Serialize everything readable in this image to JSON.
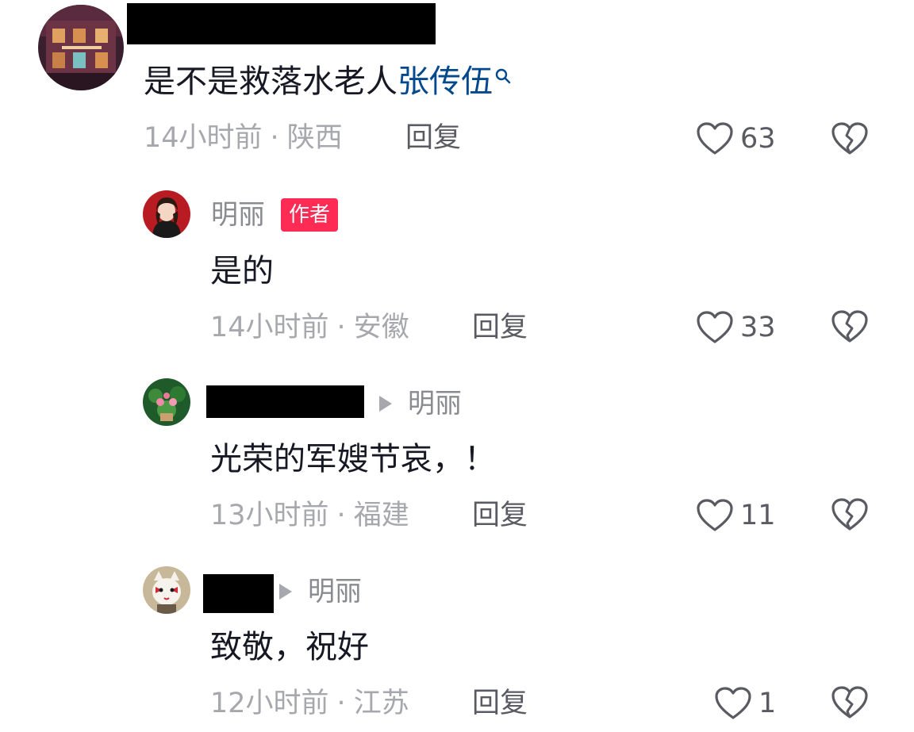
{
  "comments": [
    {
      "text": "是不是救落水老人",
      "mention": "张传伍",
      "time": "14小时前",
      "location": "陕西",
      "reply_label": "回复",
      "likes": "63"
    }
  ],
  "replies": [
    {
      "username": "明丽",
      "badge": "作者",
      "text": "是的",
      "time": "14小时前",
      "location": "安徽",
      "reply_label": "回复",
      "likes": "33"
    },
    {
      "reply_to": "明丽",
      "text": "光荣的军嫂节哀，！",
      "time": "13小时前",
      "location": "福建",
      "reply_label": "回复",
      "likes": "11"
    },
    {
      "reply_to": "明丽",
      "text": "致敬，祝好",
      "time": "12小时前",
      "location": "江苏",
      "reply_label": "回复",
      "likes": "1"
    }
  ],
  "meta_separator": "·",
  "colors": {
    "mention": "#04498d",
    "author_badge": "#fe2c55",
    "meta_gray": "#a7a8ad",
    "icon_gray": "#5a5b62"
  },
  "icons": {
    "like": "heart-outline-icon",
    "dislike": "broken-heart-icon",
    "search": "search-icon",
    "reply_arrow": "triangle-right-icon"
  }
}
